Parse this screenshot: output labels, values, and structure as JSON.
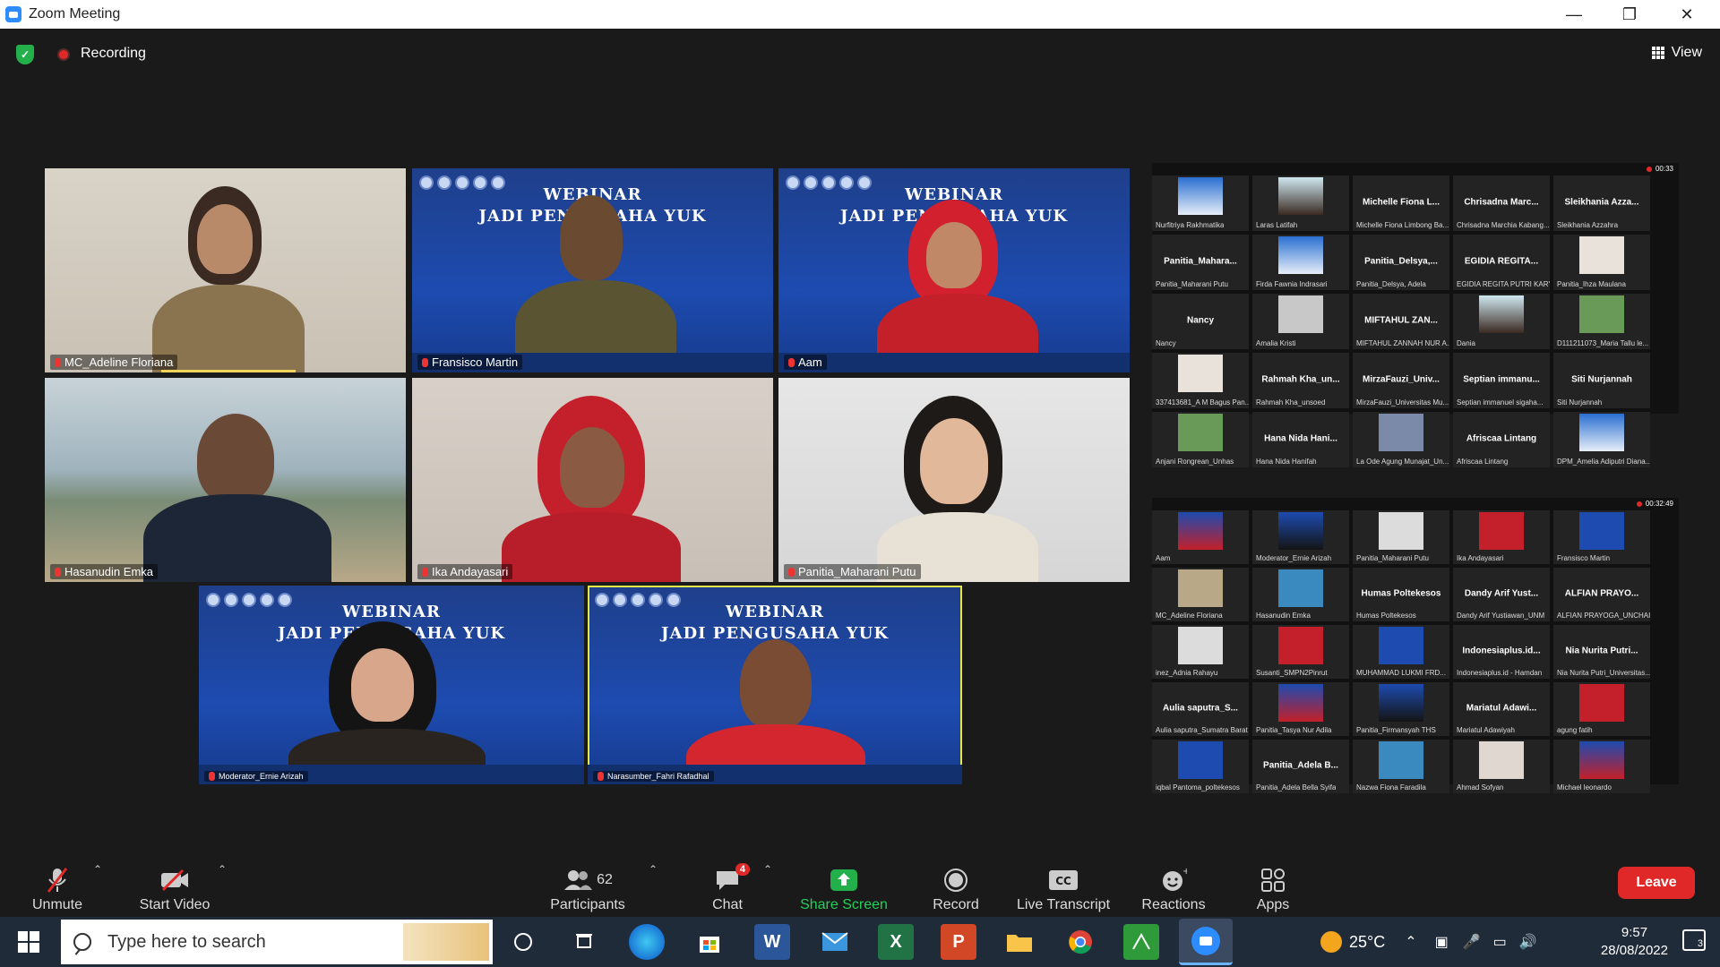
{
  "window": {
    "title": "Zoom Meeting"
  },
  "infobar": {
    "recording_label": "Recording",
    "view_label": "View"
  },
  "main_tiles": [
    {
      "name": "MC_Adeline Floriana"
    },
    {
      "name": "Fransisco Martin",
      "bg_title": "WEBINAR\nJADI PENGUSAHA YUK"
    },
    {
      "name": "Aam",
      "bg_title": "WEBINAR\nJADI PENGUSAHA YUK"
    },
    {
      "name": "Hasanudin Emka"
    },
    {
      "name": "Ika Andayasari"
    },
    {
      "name": "Panitia_Maharani Putu"
    },
    {
      "name": "Moderator_Ernie Arizah",
      "bg_title": "WEBINAR\nJADI PENGUSAHA YUK"
    },
    {
      "name": "Narasumber_Fahri Rafadhal",
      "bg_title": "WEBINAR\nJADI PENGUSAHA YUK"
    }
  ],
  "gallery_top": {
    "timer": "00:33",
    "cells": [
      {
        "big": "",
        "name": "Nurfitriya Rakhmatika"
      },
      {
        "big": "",
        "name": "Laras Latifah"
      },
      {
        "big": "Michelle Fiona L...",
        "name": "Michelle Fiona Limbong Ba..."
      },
      {
        "big": "Chrisadna Marc...",
        "name": "Chrisadna Marchia Kabang..."
      },
      {
        "big": "Sleikhania Azza...",
        "name": "Sleikhania Azzahra"
      },
      {
        "big": "Panitia_Mahara...",
        "name": "Panitia_Maharani Putu"
      },
      {
        "big": "",
        "name": "Firda Fawnia Indrasari"
      },
      {
        "big": "Panitia_Delsya,...",
        "name": "Panitia_Delsya, Adela"
      },
      {
        "big": "EGIDIA REGITA...",
        "name": "EGIDIA REGITA PUTRI KARY..."
      },
      {
        "big": "",
        "name": "Panitia_Ihza Maulana"
      },
      {
        "big": "Nancy",
        "name": "Nancy"
      },
      {
        "big": "",
        "name": "Amalia Kristi"
      },
      {
        "big": "MIFTAHUL ZAN...",
        "name": "MIFTAHUL ZANNAH NUR A..."
      },
      {
        "big": "",
        "name": "Dania"
      },
      {
        "big": "",
        "name": "D111211073_Maria Tallu le..."
      },
      {
        "big": "",
        "name": "337413681_A M Bagus Pan..."
      },
      {
        "big": "Rahmah Kha_un...",
        "name": "Rahmah Kha_unsoed"
      },
      {
        "big": "MirzaFauzi_Univ...",
        "name": "MirzaFauzi_Universitas Mu..."
      },
      {
        "big": "Septian immanu...",
        "name": "Septian immanuel sigaha..."
      },
      {
        "big": "Siti Nurjannah",
        "name": "Siti Nurjannah"
      },
      {
        "big": "",
        "name": "Anjani Rongrean_Unhas"
      },
      {
        "big": "Hana Nida Hani...",
        "name": "Hana Nida Hanifah"
      },
      {
        "big": "",
        "name": "La Ode Agung Munajat_Un..."
      },
      {
        "big": "Afriscaa Lintang",
        "name": "Afriscaa Lintang"
      },
      {
        "big": "",
        "name": "DPM_Amelia Adiputri Diana..."
      }
    ]
  },
  "gallery_bottom": {
    "timer": "00:32:49",
    "cells": [
      {
        "big": "",
        "name": "Aam"
      },
      {
        "big": "",
        "name": "Moderator_Ernie Arizah"
      },
      {
        "big": "",
        "name": "Panitia_Maharani Putu"
      },
      {
        "big": "",
        "name": "Ika Andayasari"
      },
      {
        "big": "",
        "name": "Fransisco Martin"
      },
      {
        "big": "",
        "name": "MC_Adeline Floriana"
      },
      {
        "big": "",
        "name": "Hasanudin Emka"
      },
      {
        "big": "Humas Poltekesos",
        "name": "Humas Poltekesos"
      },
      {
        "big": "Dandy Arif Yust...",
        "name": "Dandy Arif Yustiawan_UNM"
      },
      {
        "big": "ALFIAN PRAYO...",
        "name": "ALFIAN PRAYOGA_UNCHAIR"
      },
      {
        "big": "",
        "name": "inez_Adnia Rahayu"
      },
      {
        "big": "",
        "name": "Susanti_SMPN2Pinrut"
      },
      {
        "big": "",
        "name": "MUHAMMAD LUKMI FRD..."
      },
      {
        "big": "Indonesiaplus.id...",
        "name": "Indonesiaplus.id - Hamdan"
      },
      {
        "big": "Nia Nurita Putri...",
        "name": "Nia Nurita Putri_Universitas..."
      },
      {
        "big": "Aulia saputra_S...",
        "name": "Aulia saputra_Sumatra Barat"
      },
      {
        "big": "",
        "name": "Panitia_Tasya Nur Adila"
      },
      {
        "big": "",
        "name": "Panitia_Firmansyah THS"
      },
      {
        "big": "Mariatul Adawi...",
        "name": "Mariatul Adawiyah"
      },
      {
        "big": "",
        "name": "agung fatih"
      },
      {
        "big": "",
        "name": "iqbal Pantoma_poltekesos"
      },
      {
        "big": "Panitia_Adela B...",
        "name": "Panitia_Adela Bella Syifa"
      },
      {
        "big": "",
        "name": "Nazwa Fiona Faradila"
      },
      {
        "big": "",
        "name": "Ahmad Sofyan"
      },
      {
        "big": "",
        "name": "Michael leonardo"
      }
    ]
  },
  "toolbar": {
    "unmute": "Unmute",
    "start_video": "Start Video",
    "participants": "Participants",
    "participants_count": "62",
    "chat": "Chat",
    "chat_badge": "4",
    "share_screen": "Share Screen",
    "record": "Record",
    "live_transcript": "Live Transcript",
    "reactions": "Reactions",
    "apps": "Apps",
    "leave": "Leave"
  },
  "taskbar": {
    "search_placeholder": "Type here to search",
    "weather": "25°C",
    "time": "9:57",
    "date": "28/08/2022",
    "notifications": "3"
  },
  "colors": {
    "accent": "#2d8cff",
    "record": "#e02828",
    "share": "#23b04b",
    "active_speaker": "#e4e84a"
  }
}
